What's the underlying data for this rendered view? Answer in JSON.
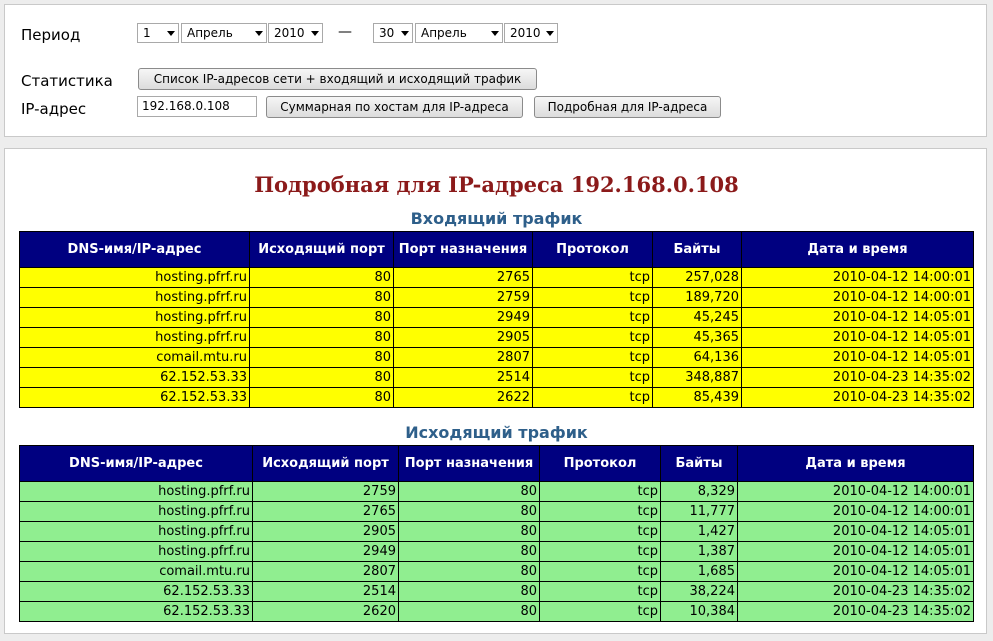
{
  "filter": {
    "period_label": "Период",
    "from": {
      "day": "1",
      "month": "Апрель",
      "year": "2010"
    },
    "separator": "—",
    "to": {
      "day": "30",
      "month": "Апрель",
      "year": "2010"
    },
    "stats_label": "Статистика",
    "stats_button": "Список IP-адресов сети  +  входящий и исходящий трафик",
    "ip_label": "IP-адрес",
    "ip_value": "192.168.0.108",
    "summary_button": "Суммарная по хостам для IP-адреса",
    "detailed_button": "Подробная для IP-адреса"
  },
  "report": {
    "title": "Подробная для IP-адреса 192.168.0.108",
    "incoming": {
      "caption": "Входящий трафик",
      "headers": [
        "DNS-имя/IP-адрес",
        "Исходящий порт",
        "Порт назначения",
        "Протокол",
        "Байты",
        "Дата и время"
      ],
      "rows": [
        [
          "hosting.pfrf.ru",
          "80",
          "2765",
          "tcp",
          "257,028",
          "2010-04-12 14:00:01"
        ],
        [
          "hosting.pfrf.ru",
          "80",
          "2759",
          "tcp",
          "189,720",
          "2010-04-12 14:00:01"
        ],
        [
          "hosting.pfrf.ru",
          "80",
          "2949",
          "tcp",
          "45,245",
          "2010-04-12 14:05:01"
        ],
        [
          "hosting.pfrf.ru",
          "80",
          "2905",
          "tcp",
          "45,365",
          "2010-04-12 14:05:01"
        ],
        [
          "comail.mtu.ru",
          "80",
          "2807",
          "tcp",
          "64,136",
          "2010-04-12 14:05:01"
        ],
        [
          "62.152.53.33",
          "80",
          "2514",
          "tcp",
          "348,887",
          "2010-04-23 14:35:02"
        ],
        [
          "62.152.53.33",
          "80",
          "2622",
          "tcp",
          "85,439",
          "2010-04-23 14:35:02"
        ]
      ]
    },
    "outgoing": {
      "caption": "Исходящий трафик",
      "headers": [
        "DNS-имя/IP-адрес",
        "Исходящий порт",
        "Порт назначения",
        "Протокол",
        "Байты",
        "Дата и время"
      ],
      "rows": [
        [
          "hosting.pfrf.ru",
          "2759",
          "80",
          "tcp",
          "8,329",
          "2010-04-12 14:00:01"
        ],
        [
          "hosting.pfrf.ru",
          "2765",
          "80",
          "tcp",
          "11,777",
          "2010-04-12 14:00:01"
        ],
        [
          "hosting.pfrf.ru",
          "2905",
          "80",
          "tcp",
          "1,427",
          "2010-04-12 14:05:01"
        ],
        [
          "hosting.pfrf.ru",
          "2949",
          "80",
          "tcp",
          "1,387",
          "2010-04-12 14:05:01"
        ],
        [
          "comail.mtu.ru",
          "2807",
          "80",
          "tcp",
          "1,685",
          "2010-04-12 14:05:01"
        ],
        [
          "62.152.53.33",
          "2514",
          "80",
          "tcp",
          "38,224",
          "2010-04-23 14:35:02"
        ],
        [
          "62.152.53.33",
          "2620",
          "80",
          "tcp",
          "10,384",
          "2010-04-23 14:35:02"
        ]
      ]
    }
  },
  "colors": {
    "header_bg": "#000080",
    "incoming_row_bg": "#ffff00",
    "outgoing_row_bg": "#90ee90",
    "title_color": "#8b1a1a",
    "caption_color": "#2e5f8a"
  }
}
